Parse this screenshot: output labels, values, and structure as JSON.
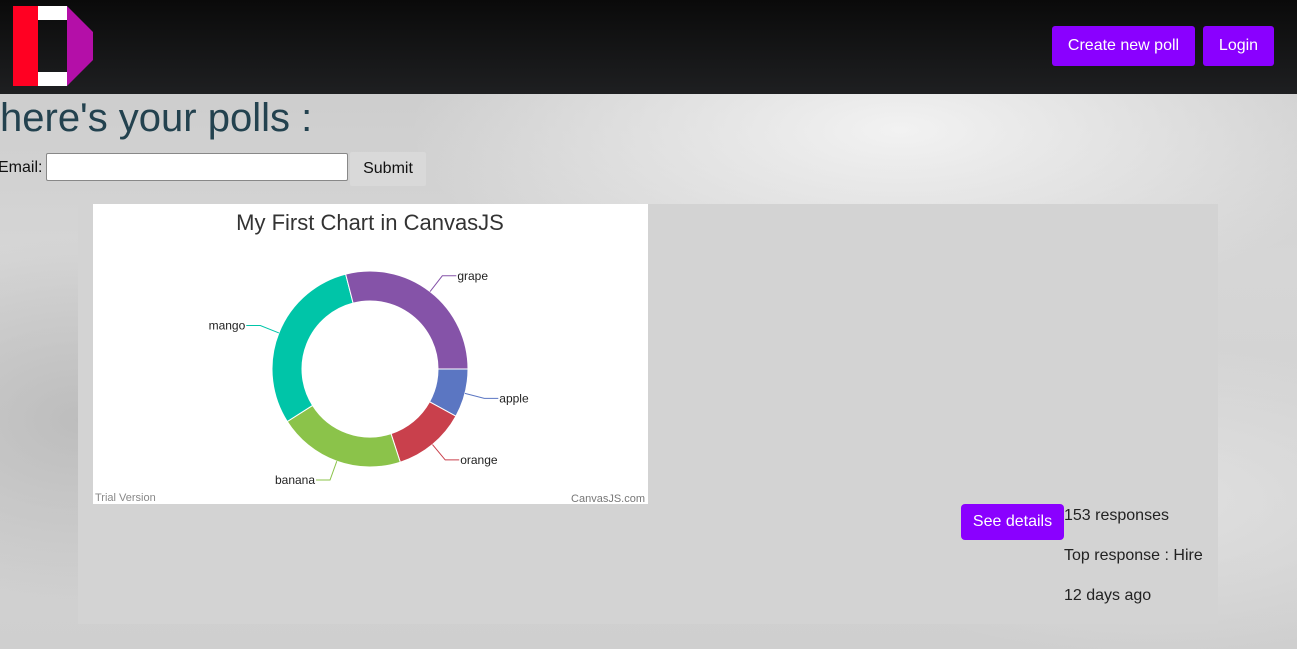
{
  "nav": {
    "create_label": "Create new poll",
    "login_label": "Login",
    "logo_colors": {
      "red": "#ff0022",
      "white": "#ffffff",
      "purple": "#b40fa8"
    }
  },
  "page": {
    "title": "here's your polls :",
    "email_label": "Email:",
    "email_value": "",
    "submit_label": "Submit"
  },
  "poll": {
    "details_label": "See details",
    "responses": "153 responses",
    "top_response": "Top response : Hire",
    "age": "12 days ago"
  },
  "chart_data": {
    "type": "pie",
    "variant": "doughnut",
    "title": "My First Chart in CanvasJS",
    "slices": [
      {
        "label": "apple",
        "value": 8,
        "color": "#5b76c2"
      },
      {
        "label": "orange",
        "value": 12,
        "color": "#c9404c"
      },
      {
        "label": "banana",
        "value": 21,
        "color": "#8bc34a"
      },
      {
        "label": "mango",
        "value": 30,
        "color": "#00c5a8"
      },
      {
        "label": "grape",
        "value": 29,
        "color": "#8553a8"
      }
    ],
    "watermark_left": "Trial Version",
    "watermark_right": "CanvasJS.com"
  }
}
